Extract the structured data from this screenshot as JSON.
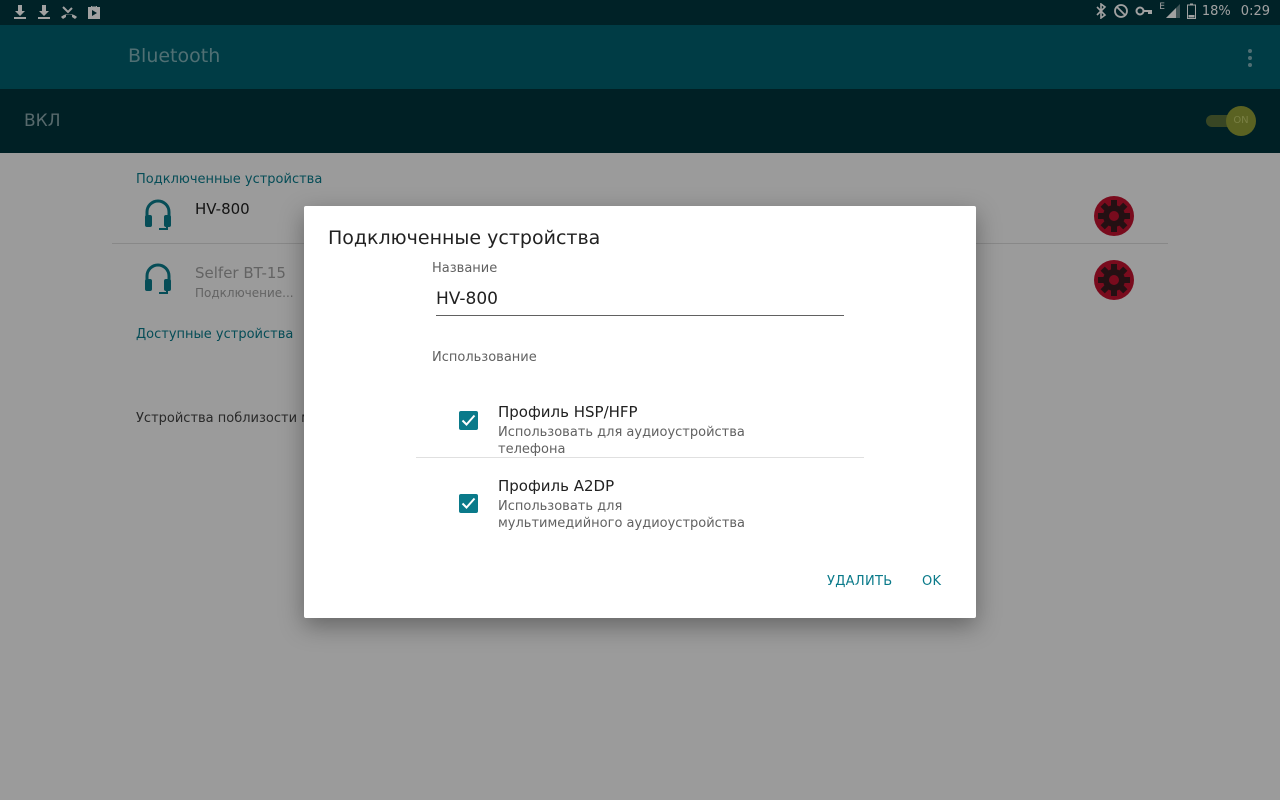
{
  "status_bar": {
    "left_icons": [
      "download-icon",
      "download-icon",
      "missed-call-icon",
      "play-store-icon"
    ],
    "right_icons": [
      "bluetooth-icon",
      "do-not-disturb-icon",
      "vpn-key-icon",
      "signal-icon",
      "battery-icon"
    ],
    "network_type": "E",
    "battery": "18%",
    "time": "0:29"
  },
  "app_bar": {
    "title": "Bluetooth"
  },
  "switch_bar": {
    "label": "ВКЛ",
    "toggle_text": "ON",
    "toggle_on": true
  },
  "paired": {
    "header": "Подключенные устройства",
    "devices": [
      {
        "name": "HV-800",
        "status": ""
      },
      {
        "name": "Selfer BT-15",
        "status": "Подключение..."
      }
    ]
  },
  "available": {
    "header": "Доступные устройства"
  },
  "nearby_text": "Устройства поблизости мо",
  "dialog": {
    "title": "Подключенные устройства",
    "name_label": "Название",
    "name_value": "HV-800",
    "usage_label": "Использование",
    "profiles": [
      {
        "title": "Профиль HSP/HFP",
        "subtitle": "Использовать для аудиоустройства телефона",
        "checked": true
      },
      {
        "title": "Профиль A2DP",
        "subtitle": "Использовать для мультимедийного аудиоустройства",
        "checked": true
      }
    ],
    "delete_label": "УДАЛИТЬ",
    "ok_label": "OK"
  },
  "colors": {
    "accent": "#0a7a8a",
    "app_bar": "#00606e",
    "switch_bar": "#00343c",
    "gear": "#c0122e"
  }
}
